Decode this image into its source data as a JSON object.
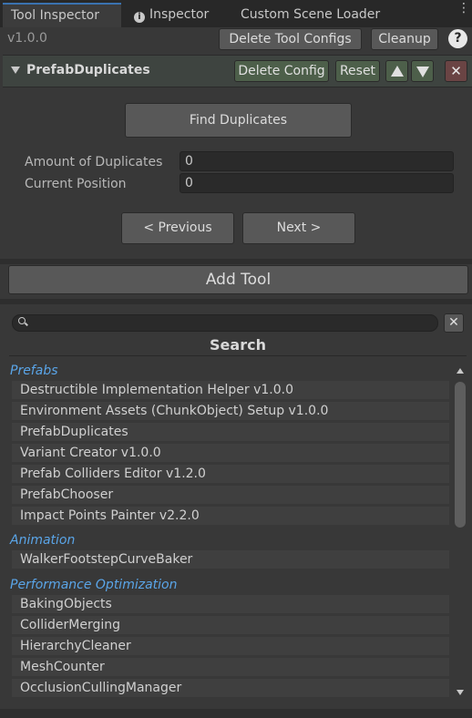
{
  "tabs": [
    {
      "label": "Tool Inspector"
    },
    {
      "label": "Inspector"
    },
    {
      "label": "Custom Scene Loader"
    }
  ],
  "toolbar": {
    "version": "v1.0.0",
    "delete_configs_label": "Delete Tool Configs",
    "cleanup_label": "Cleanup",
    "help_label": "?"
  },
  "tool": {
    "title": "PrefabDuplicates",
    "delete_config_label": "Delete Config",
    "reset_label": "Reset",
    "close_label": "✕",
    "find_label": "Find Duplicates",
    "fields": [
      {
        "label": "Amount of Duplicates",
        "value": "0"
      },
      {
        "label": "Current Position",
        "value": "0"
      }
    ],
    "prev_label": "< Previous",
    "next_label": "Next >"
  },
  "add_tool_label": "Add Tool",
  "picker": {
    "search_value": "",
    "clear_label": "✕",
    "title": "Search",
    "categories": [
      {
        "name": "Prefabs",
        "items": [
          "Destructible Implementation Helper v1.0.0",
          "Environment Assets (ChunkObject) Setup v1.0.0",
          "PrefabDuplicates",
          "Variant Creator v1.0.0",
          "Prefab Colliders Editor v1.2.0",
          "PrefabChooser",
          "Impact Points Painter v2.2.0"
        ]
      },
      {
        "name": "Animation",
        "items": [
          "WalkerFootstepCurveBaker"
        ]
      },
      {
        "name": "Performance Optimization",
        "items": [
          "BakingObjects",
          "ColliderMerging",
          "HierarchyCleaner",
          "MeshCounter",
          "OcclusionCullingManager"
        ]
      }
    ]
  },
  "colors": {
    "background": "#383838",
    "tabbar": "#282828",
    "accent_tab": "#3a72b0",
    "green_button": "#4d5f4a",
    "red_button": "#6a4444",
    "category_text": "#5aa5e8"
  }
}
